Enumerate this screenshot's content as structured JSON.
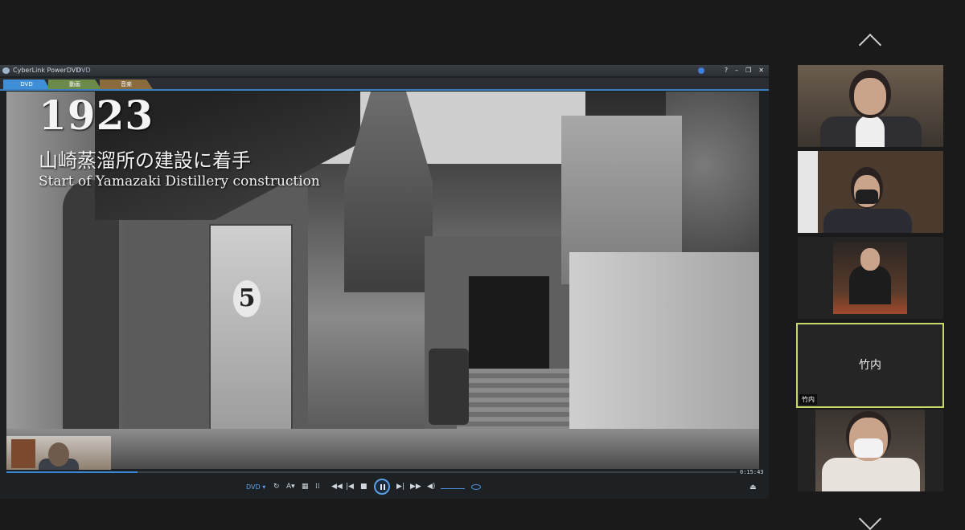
{
  "player": {
    "app_title": "CyberLink PowerDVD",
    "app_subtitle": "DVD",
    "tabs": [
      {
        "label": "DVD"
      },
      {
        "label": "動画"
      },
      {
        "label": "音楽"
      }
    ],
    "window_buttons": {
      "help": "?",
      "minimize": "–",
      "restore": "❐",
      "close": "✕"
    },
    "video": {
      "year": "1923",
      "caption_jp": "山崎蒸溜所の建設に着手",
      "caption_en": "Start of Yamazaki Distillery construction",
      "gate_number": "5"
    },
    "time": "0:15:43",
    "progress": 0.18,
    "controls": {
      "dvd_menu": "DVD ▾",
      "repeat": "↻",
      "subtitle": "A▾",
      "chapters": "▦",
      "settings": "⁞⁞",
      "rewind": "◀◀",
      "prev": "|◀",
      "stop": "■",
      "next": "▶|",
      "forward": "▶▶",
      "volume": "◀)",
      "eject": "⏏"
    }
  },
  "participants": {
    "active_name": "竹内",
    "active_tag": "竹内"
  },
  "colors": {
    "accent_blue": "#3c86d6",
    "active_border": "#c6d96a"
  }
}
